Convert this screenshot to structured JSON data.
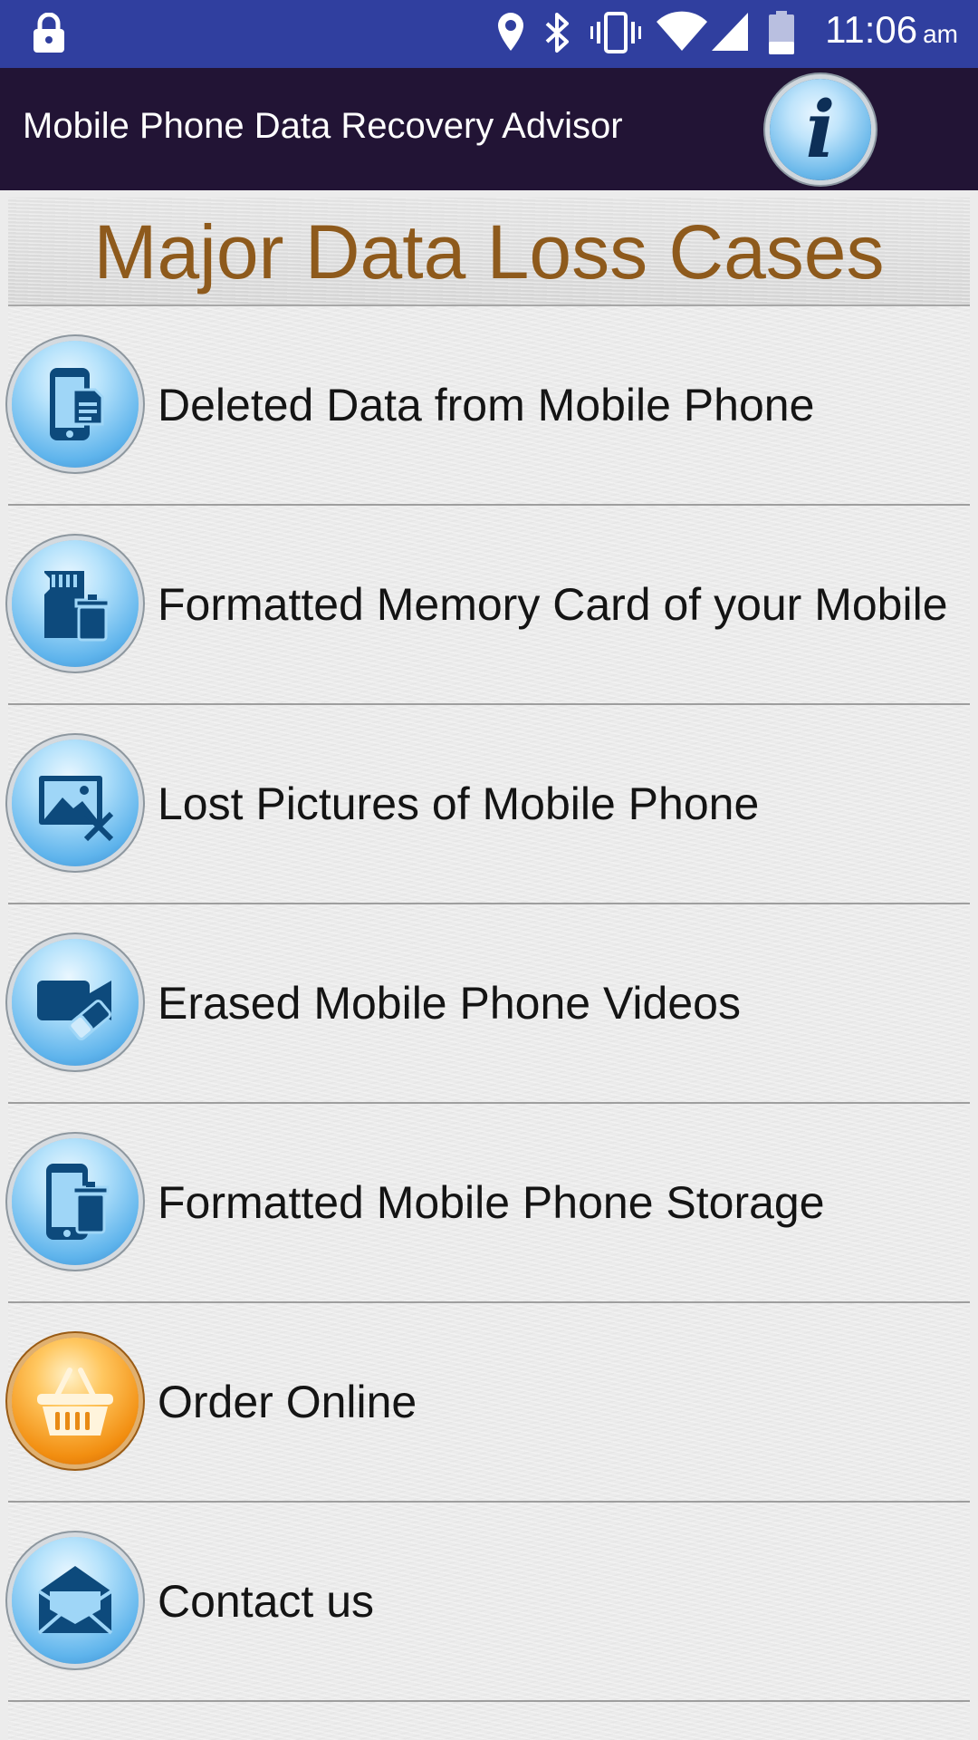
{
  "status_bar": {
    "time": "11:06",
    "ampm": "am",
    "icons": [
      "lock-icon",
      "location-icon",
      "bluetooth-icon",
      "vibrate-icon",
      "wifi-icon",
      "signal-icon",
      "battery-icon"
    ]
  },
  "app_bar": {
    "title": "Mobile Phone Data Recovery Advisor",
    "info_glyph": "i"
  },
  "header": {
    "title": "Major Data Loss Cases"
  },
  "cases": [
    {
      "label": "Deleted Data from Mobile Phone",
      "icon": "phone-document-icon"
    },
    {
      "label": "Formatted Memory Card of your Mobile",
      "icon": "memory-card-trash-icon"
    },
    {
      "label": "Lost Pictures of Mobile Phone",
      "icon": "picture-delete-icon"
    },
    {
      "label": "Erased Mobile Phone Videos",
      "icon": "video-eraser-icon"
    },
    {
      "label": "Formatted Mobile Phone Storage",
      "icon": "phone-trash-icon"
    },
    {
      "label": "Order Online",
      "icon": "shopping-basket-icon"
    },
    {
      "label": "Contact us",
      "icon": "envelope-icon"
    }
  ],
  "colors": {
    "status_bar": "#303f9f",
    "app_bar": "#221435",
    "header_title": "#8e5a1c",
    "icon_blue": "#5fb4ec",
    "icon_orange": "#f28e10"
  }
}
